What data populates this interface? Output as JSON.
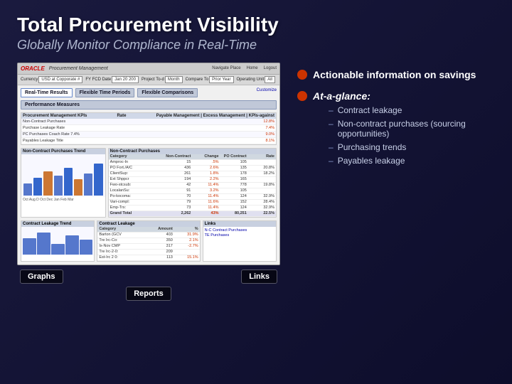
{
  "slide": {
    "main_title": "Total Procurement Visibility",
    "subtitle": "Globally Monitor Compliance in Real-Time"
  },
  "screenshot": {
    "oracle_logo": "ORACLE",
    "proc_mgmt": "Procurement Management",
    "nav_items": [
      "Navigate Place",
      "Home",
      "Logout"
    ],
    "toolbar": {
      "fields": [
        {
          "label": "Currency",
          "value": "USD at Copporate #"
        },
        {
          "label": "FY FCD Date",
          "value": "Jan 20 200"
        },
        {
          "label": "Project To-d",
          "value": "Month"
        },
        {
          "label": "Compare To",
          "value": "Prior Year"
        },
        {
          "label": "Operating Unit",
          "value": "All"
        }
      ]
    },
    "buttons": [
      {
        "label": "Real-Time Results"
      },
      {
        "label": "Flexible Time Periods"
      },
      {
        "label": "Flexible Comparisons"
      },
      {
        "label": "Performance Measures"
      }
    ],
    "table": {
      "title": "Procurement Management KPIs",
      "rows": [
        {
          "name": "Non-Contract Purchases",
          "val1": "",
          "pct": "12.8%"
        },
        {
          "name": "Purchase Leakage Rate",
          "val1": "",
          "pct": "7.4%"
        },
        {
          "name": "PC Purchases Conch Rate",
          "val1": "7.4%",
          "pct": "9.0%"
        },
        {
          "name": "Payables Leakage Title",
          "val1": "",
          "pct": "8.1%"
        }
      ]
    },
    "panels": {
      "left_chart": "Non-Contract Purchases Trend",
      "right_table": "Non-Contract Purchases",
      "right_table_cols": [
        "Category",
        "Non-Contract Purchases Amount",
        "Change",
        "PO Contract Amount",
        "Non-Contract Rate"
      ],
      "right_table_rows": [
        [
          "Amproc-In",
          "15",
          ".5%",
          "105",
          ""
        ],
        [
          "PO Fort./A/C",
          "436",
          "2.6%",
          "135",
          "20.8%"
        ],
        [
          "ClientSup:",
          "261",
          "1.8%",
          "178",
          "18.2%"
        ],
        [
          "Ext Shppcr",
          "194",
          "2.2%",
          "165",
          ""
        ],
        [
          "Fwo-stcsub:",
          "42",
          "11.4%",
          "778",
          "19.8%"
        ],
        [
          "LocalanSu:",
          "91",
          "3.2%",
          "105",
          ""
        ],
        [
          "Po-kocoma:",
          "70",
          "11.4%",
          "124",
          "32.9%"
        ],
        [
          "Vari-compl:",
          "79",
          "11.6%",
          "152",
          "28.4%"
        ],
        [
          "Emp-Trs:",
          "73",
          "11.4%",
          "124",
          "32.9%"
        ],
        [
          "Grand Total",
          "2,262",
          "43%",
          "80,251",
          "22.5%"
        ]
      ]
    },
    "bottom_panels": {
      "left": "Contract Leakage Trend",
      "middle_table": "Contract Leakage",
      "right": "Links"
    },
    "floating_labels": {
      "graphs": "Graphs",
      "links": "Links",
      "reports": "Reports"
    }
  },
  "bullets": {
    "first_bullet": {
      "text": "Actionable information on savings"
    },
    "second_bullet": {
      "title": "At-a-glance:",
      "items": [
        "Contract leakage",
        "Non-contract purchases (sourcing opportunities)",
        "Purchasing trends",
        "Payables leakage"
      ]
    }
  }
}
